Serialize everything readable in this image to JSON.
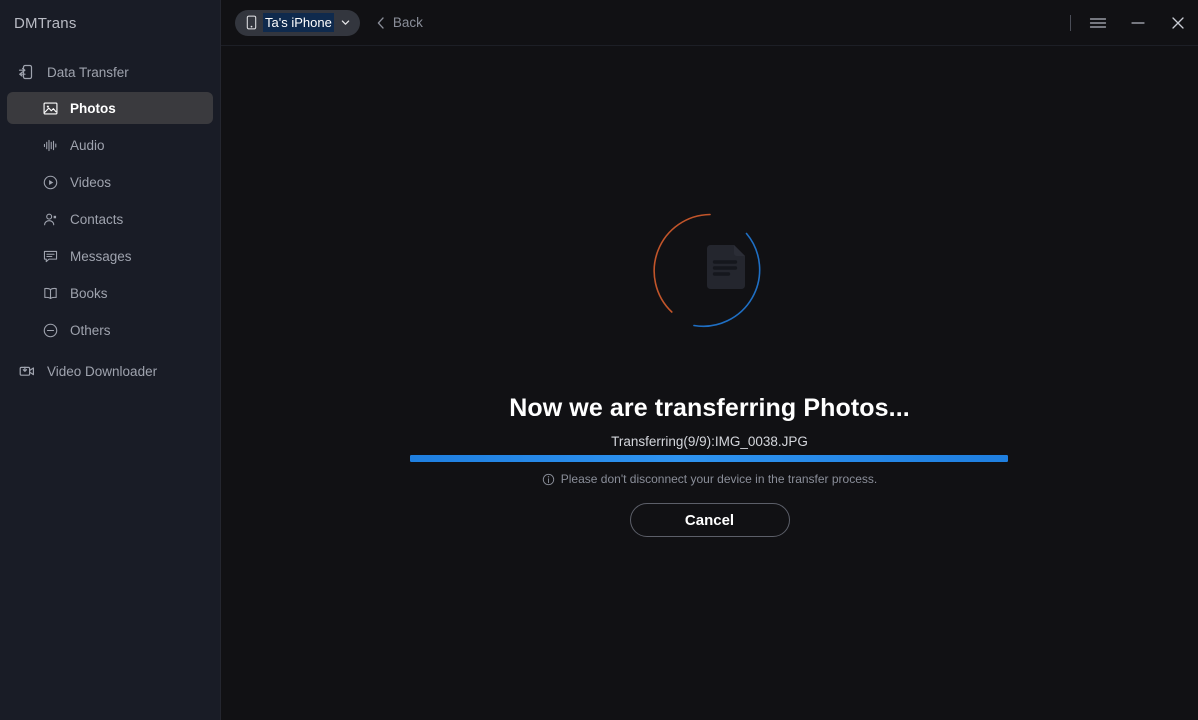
{
  "app": {
    "brand": "DMTrans"
  },
  "sidebar": {
    "groups": [
      {
        "label": "Data Transfer",
        "icon": "phone-transfer-icon",
        "items": [
          {
            "label": "Photos",
            "icon": "photo-icon",
            "active": true
          },
          {
            "label": "Audio",
            "icon": "audio-icon",
            "active": false
          },
          {
            "label": "Videos",
            "icon": "video-icon",
            "active": false
          },
          {
            "label": "Contacts",
            "icon": "contact-icon",
            "active": false
          },
          {
            "label": "Messages",
            "icon": "message-icon",
            "active": false
          },
          {
            "label": "Books",
            "icon": "book-icon",
            "active": false
          },
          {
            "label": "Others",
            "icon": "others-icon",
            "active": false
          }
        ]
      }
    ],
    "video_downloader": {
      "label": "Video Downloader",
      "icon": "video-download-icon"
    }
  },
  "topbar": {
    "device_name": "Ta's iPhone",
    "device_icon": "phone-icon",
    "dropdown_icon": "chevron-down-icon",
    "back_label": "Back",
    "back_icon": "chevron-left-icon",
    "menu_icon": "hamburger-menu-icon",
    "minimize_icon": "minimize-icon",
    "close_icon": "close-icon"
  },
  "transfer": {
    "title": "Now we are transferring Photos...",
    "status": "Transferring(9/9):IMG_0038.JPG",
    "progress_percent": 100,
    "hint": "Please don't disconnect your device in the transfer process.",
    "hint_icon": "info-icon",
    "cancel_label": "Cancel",
    "spinner_icon": "document-spinner-icon"
  },
  "colors": {
    "accent_blue": "#2e93f0",
    "arc_orange": "#c2552a",
    "arc_blue": "#1f6fc4",
    "sidebar_bg": "#191c26",
    "content_bg": "#111114",
    "active_row": "#3a3a3e"
  }
}
